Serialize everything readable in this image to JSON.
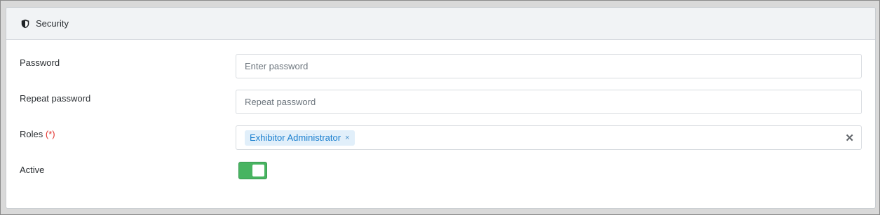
{
  "section": {
    "title": "Security",
    "icon": "shield-icon"
  },
  "fields": {
    "password": {
      "label": "Password",
      "placeholder": "Enter password",
      "value": ""
    },
    "repeat_password": {
      "label": "Repeat password",
      "placeholder": "Repeat password",
      "value": ""
    },
    "roles": {
      "label": "Roles",
      "required_marker": "(*)",
      "selected": [
        "Exhibitor Administrator"
      ],
      "tag_remove_glyph": "×",
      "clear_glyph": "✕"
    },
    "active": {
      "label": "Active",
      "value": true
    }
  },
  "colors": {
    "toggle_on": "#48b461",
    "tag_background": "#e1effa",
    "tag_text": "#1a7fcf",
    "required": "#e3342f"
  }
}
